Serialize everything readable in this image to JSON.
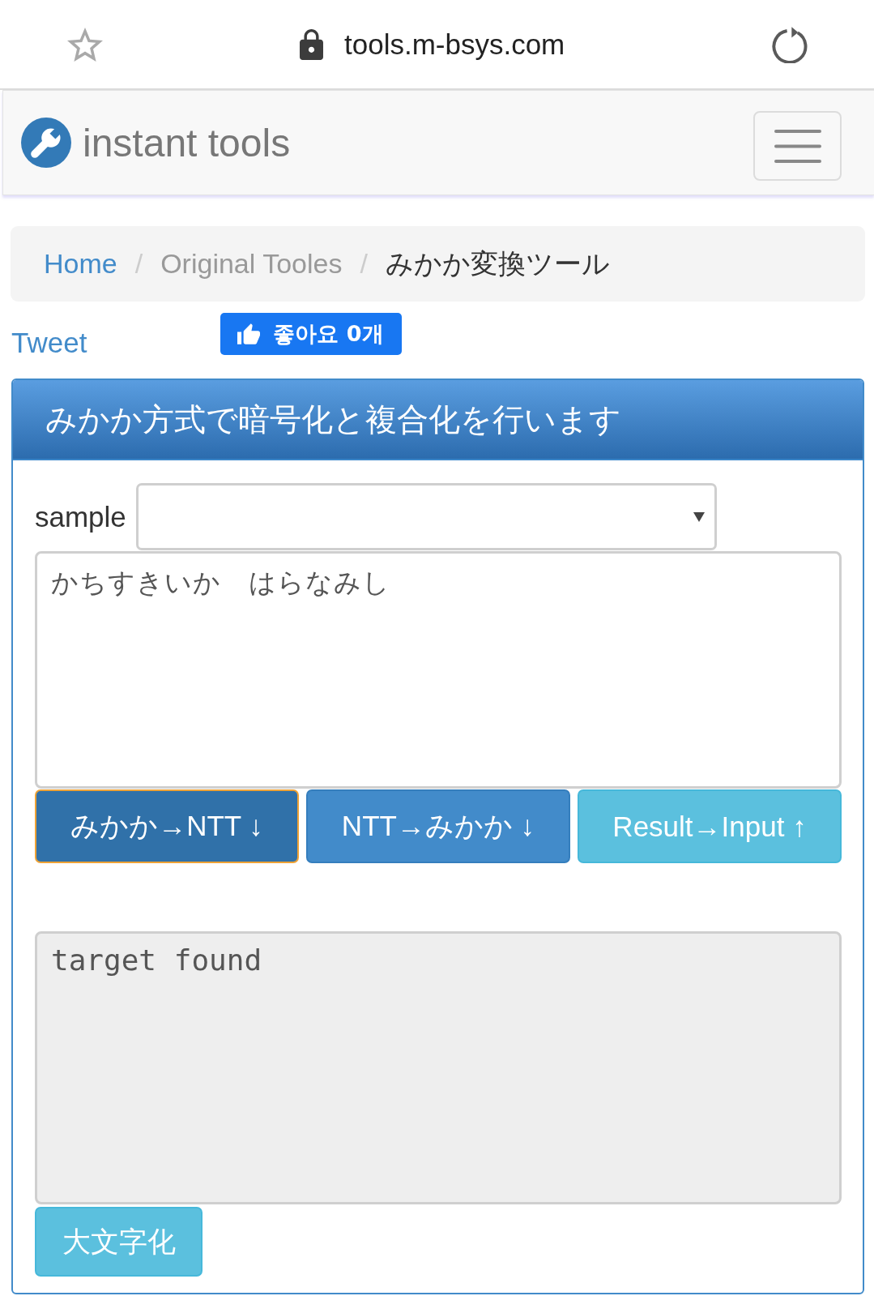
{
  "browser": {
    "url": "tools.m-bsys.com"
  },
  "navbar": {
    "brand": "instant tools"
  },
  "breadcrumb": {
    "items": [
      {
        "label": "Home",
        "kind": "link"
      },
      {
        "label": "Original Tooles",
        "kind": "muted"
      },
      {
        "label": "みかか変換ツール",
        "kind": "current"
      }
    ],
    "separators": [
      "/",
      "/"
    ]
  },
  "social": {
    "tweet": "Tweet",
    "like": "좋아요 0개"
  },
  "panel": {
    "title": "みかか方式で暗号化と複合化を行います",
    "sample_label": "sample",
    "input": {
      "value": "かちすきいか　はらなみし",
      "readonly": false
    },
    "buttons": [
      {
        "label": "みかか→NTT ↓",
        "kind": "primary",
        "focused": true
      },
      {
        "label": "NTT→みかか ↓",
        "kind": "primary",
        "focused": false
      },
      {
        "label": "Result→Input ↑",
        "kind": "info",
        "focused": false
      }
    ],
    "output": {
      "value": "target found",
      "readonly": true
    },
    "case_button": {
      "label": "大文字化",
      "kind": "info"
    }
  }
}
